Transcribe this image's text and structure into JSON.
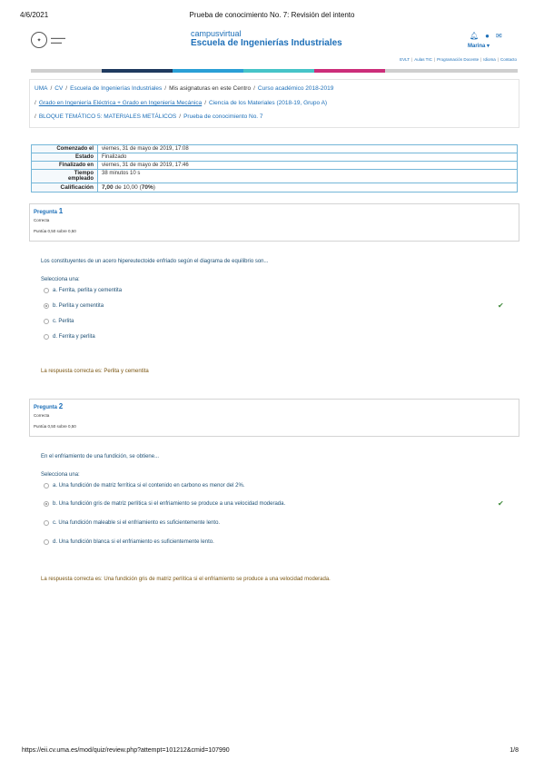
{
  "print_header": {
    "date": "4/6/2021",
    "title": "Prueba de conocimiento No. 7: Revisión del intento"
  },
  "print_footer": {
    "url": "https://eii.cv.uma.es/mod/quiz/review.php?attempt=101212&cmid=107990",
    "page": "1/8"
  },
  "site": {
    "brand_line1": "campusvirtual",
    "brand_line2": "Escuela de Ingenierías Industriales",
    "user_name": "Marina"
  },
  "top_links": [
    "EVLT",
    "Aulas TIC",
    "Programación Docente",
    "Idioma",
    "Contacto"
  ],
  "colorbar": [
    "#cfcfcf",
    "#1f3a5f",
    "#2a9fd6",
    "#46c4c8",
    "#cc2d7a",
    "#cfcfcf"
  ],
  "breadcrumb": {
    "line1": [
      "UMA",
      "CV",
      "Escuela de Ingenierías Industriales",
      "Mis asignaturas en este Centro",
      "Curso académico 2018-2019"
    ],
    "line2": [
      "Grado en Ingeniería Eléctrica + Grado en Ingeniería Mecánica",
      "Ciencia de los Materiales (2018-19, Grupo A)"
    ],
    "line3": [
      "BLOQUE TEMÁTICO 5: MATERIALES METÁLICOS",
      "Prueba de conocimiento No. 7"
    ]
  },
  "summary": {
    "started_label": "Comenzado el",
    "started_value": "viernes, 31 de mayo de 2019, 17:08",
    "state_label": "Estado",
    "state_value": "Finalizado",
    "finished_label": "Finalizado en",
    "finished_value": "viernes, 31 de mayo de 2019, 17:46",
    "time_label_1": "Tiempo",
    "time_label_2": "empleado",
    "time_value": "38 minutos 10 s",
    "grade_label": "Calificación",
    "grade_score": "7,00",
    "grade_rest": " de 10,00 (",
    "grade_pct": "70%",
    "grade_close": ")"
  },
  "q1": {
    "label": "Pregunta",
    "number": "1",
    "status": "Correcta",
    "mark": "Puntúa 0,50 sobre 0,50",
    "text": "Los constituyentes de un acero hipereutectoide enfriado según el diagrama de equilibrio son...",
    "prompt": "Selecciona una:",
    "options": [
      "a. Ferrita, perlita y cementita",
      "b. Perlita y cementita",
      "c. Perlita",
      "d. Ferrita y perlita"
    ],
    "feedback": "La respuesta correcta es: Perlita y cementita"
  },
  "q2": {
    "label": "Pregunta",
    "number": "2",
    "status": "Correcta",
    "mark": "Puntúa 0,50 sobre 0,50",
    "text": "En el enfriamiento de una fundición, se obtiene...",
    "prompt": "Selecciona una:",
    "options": [
      "a. Una fundición de matriz ferrítica si el contenido en carbono es menor del 2%.",
      "b. Una fundición gris de matriz perlítica si el enfriamiento se produce a una velocidad moderada.",
      "c. Una fundición maleable si el enfriamiento es suficientemente lento.",
      "d. Una fundición blanca si el enfriamiento es suficientemente lento."
    ],
    "feedback": "La respuesta correcta es: Una fundición gris de matriz perlítica si el enfriamiento se produce a una velocidad moderada."
  }
}
